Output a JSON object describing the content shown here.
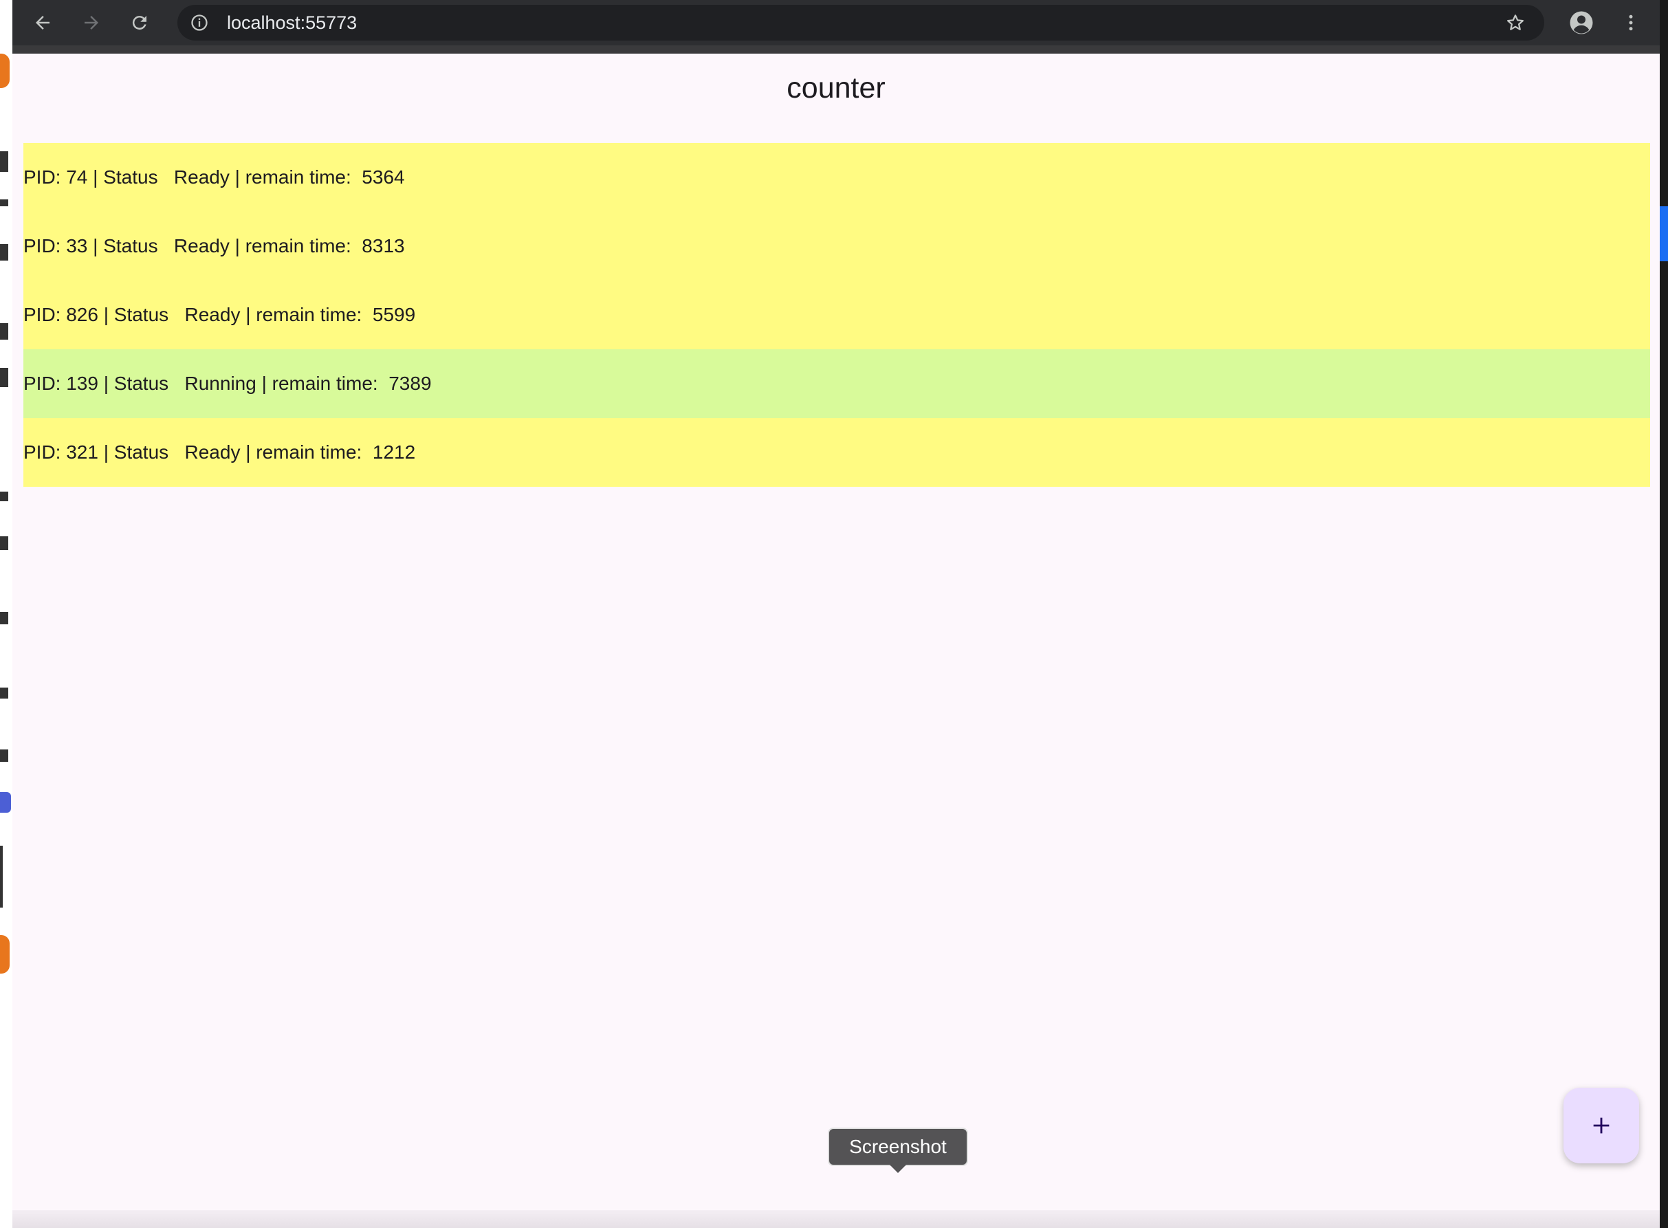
{
  "browser": {
    "url": "localhost:55773",
    "icons": {
      "back": "back-arrow-icon",
      "forward": "forward-arrow-icon",
      "reload": "reload-icon",
      "site_info": "info-icon",
      "bookmark": "star-icon",
      "profile": "profile-icon",
      "menu": "kebab-menu-icon"
    }
  },
  "app": {
    "title": "counter",
    "processes": [
      {
        "text": "PID: 74 | Status   Ready | remain time:  5364",
        "status": "Ready"
      },
      {
        "text": "PID: 33 | Status   Ready | remain time:  8313",
        "status": "Ready"
      },
      {
        "text": "PID: 826 | Status   Ready | remain time:  5599",
        "status": "Ready"
      },
      {
        "text": "PID: 139 | Status   Running | remain time:  7389",
        "status": "Running"
      },
      {
        "text": "PID: 321 | Status   Ready | remain time:  1212",
        "status": "Ready"
      }
    ],
    "colors": {
      "ready": "#fffb82",
      "running": "#d8fa9a",
      "fab": "#eaddff"
    },
    "fab_icon": "plus-icon"
  },
  "tooltip": {
    "label": "Screenshot"
  }
}
